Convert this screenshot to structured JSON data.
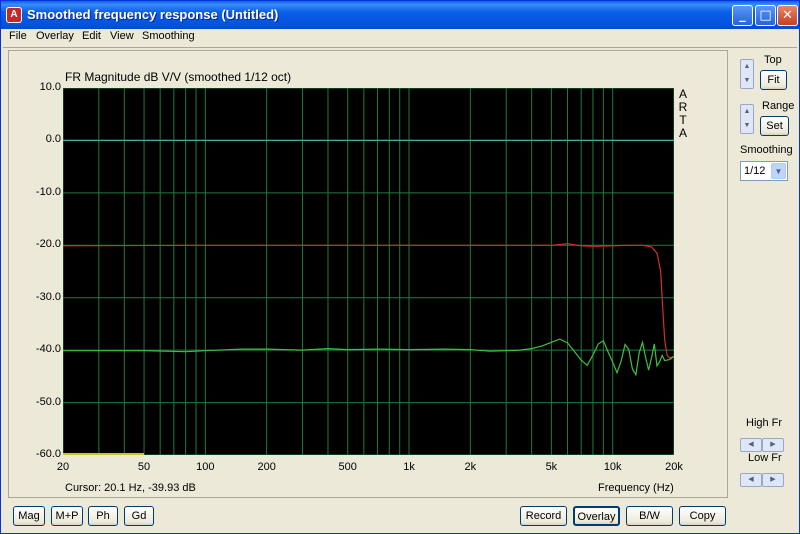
{
  "window": {
    "title": "Smoothed frequency response (Untitled)",
    "icon": "app-icon",
    "controls": {
      "minimize": "_",
      "maximize": "□",
      "close": "✕"
    }
  },
  "menu": [
    "File",
    "Overlay",
    "Edit",
    "View",
    "Smoothing"
  ],
  "plot": {
    "title": "FR Magnitude dB V/V (smoothed 1/12 oct)",
    "watermark": [
      "A",
      "R",
      "T",
      "A"
    ],
    "cursor": "Cursor: 20.1 Hz, -39.93 dB",
    "xlabel": "Frequency (Hz)"
  },
  "chart_data": {
    "type": "line",
    "title": "FR Magnitude dB V/V (smoothed 1/12 oct)",
    "xlabel": "Frequency (Hz)",
    "ylabel": "",
    "xscale": "log",
    "xlim": [
      20,
      20000
    ],
    "ylim": [
      -60,
      10
    ],
    "x_ticks": [
      "20",
      "50",
      "100",
      "200",
      "500",
      "1k",
      "2k",
      "5k",
      "10k",
      "20k"
    ],
    "y_ticks": [
      "10.0",
      "0.0",
      "-10.0",
      "-20.0",
      "-30.0",
      "-40.0",
      "-50.0",
      "-60.0"
    ],
    "grid": true,
    "background": "#000000",
    "series": [
      {
        "color": "#4aa8a8",
        "x": [
          20,
          20000
        ],
        "y": [
          0,
          0
        ]
      },
      {
        "color": "#d03030",
        "x": [
          20,
          100,
          1000,
          5000,
          6000,
          7000,
          8000,
          10000,
          12000,
          14000,
          15500,
          16500,
          17200,
          17600,
          18000,
          18500,
          19000,
          20000
        ],
        "y": [
          -20.1,
          -20.0,
          -20.0,
          -20.0,
          -19.7,
          -20.1,
          -20.2,
          -20.1,
          -20.0,
          -20.0,
          -20.3,
          -21.5,
          -25,
          -32,
          -38,
          -41,
          -41.5,
          -41.2
        ]
      },
      {
        "color": "#40c040",
        "x": [
          20,
          50,
          80,
          100,
          150,
          200,
          300,
          400,
          500,
          700,
          1000,
          1500,
          2000,
          2500,
          3000,
          3500,
          4000,
          4500,
          5000,
          5500,
          6000,
          6500,
          7000,
          7500,
          8000,
          8500,
          9000,
          9500,
          10000,
          10500,
          11000,
          11500,
          12000,
          12500,
          13000,
          13500,
          14000,
          14500,
          15000,
          15500,
          16000,
          16500,
          17000,
          17500,
          18000,
          19000,
          20000
        ],
        "y": [
          -40.1,
          -40.1,
          -40.3,
          -40.1,
          -39.8,
          -39.8,
          -40.0,
          -39.7,
          -39.9,
          -39.8,
          -39.9,
          -39.8,
          -39.9,
          -40.2,
          -40.1,
          -40.0,
          -39.7,
          -39.2,
          -38.5,
          -37.9,
          -38.6,
          -40.3,
          -41.9,
          -42.9,
          -40.9,
          -38.8,
          -38.2,
          -40.4,
          -42.3,
          -44.3,
          -42.1,
          -38.9,
          -39.9,
          -43.6,
          -44.7,
          -40.5,
          -38.5,
          -41.4,
          -43.8,
          -41.5,
          -38.8,
          -43.0,
          -42.2,
          -41.0,
          -42.0,
          -41.8,
          -41.2
        ]
      },
      {
        "color": "#c8c820",
        "x": [
          20,
          50
        ],
        "y": [
          -59.8,
          -59.8
        ]
      }
    ]
  },
  "right_panel": {
    "top_label": "Top",
    "fit_label": "Fit",
    "range_label": "Range",
    "set_label": "Set",
    "smoothing_label": "Smoothing",
    "smoothing_value": "1/12",
    "high_fr_label": "High Fr",
    "low_fr_label": "Low Fr"
  },
  "bottom_buttons": {
    "left": [
      "Mag",
      "M+P",
      "Ph",
      "Gd"
    ],
    "right": [
      "Record",
      "Overlay",
      "B/W",
      "Copy"
    ]
  }
}
